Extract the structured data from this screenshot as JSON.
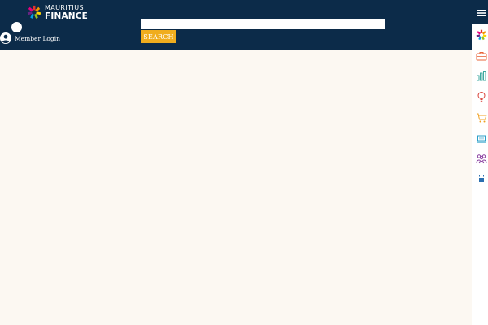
{
  "brand": {
    "logo_line1": "MAURITIUS",
    "logo_line2": "FINANCE",
    "logo_colors": [
      "#e6332a",
      "#f39200",
      "#ffd500",
      "#95c11f",
      "#009fe3",
      "#662483",
      "#e5007e"
    ]
  },
  "header": {
    "background": "#0c2b49",
    "member_login_label": "Member Login",
    "member_icon": "user-circle-icon",
    "menu_icon": "hamburger-icon"
  },
  "search": {
    "value": "",
    "placeholder": "",
    "button_label": "SEARCH",
    "button_color": "#f0ad1e"
  },
  "side_rail": {
    "items": [
      {
        "icon": "logo-mark-icon"
      },
      {
        "icon": "briefcase-icon",
        "color": "#e8643a"
      },
      {
        "icon": "bar-chart-icon",
        "color": "#3fa9a0"
      },
      {
        "icon": "lightbulb-icon",
        "color": "#d9433a"
      },
      {
        "icon": "shopping-cart-icon",
        "color": "#f0a020"
      },
      {
        "icon": "laptop-icon",
        "color": "#2b9fc9"
      },
      {
        "icon": "people-icon",
        "color": "#8a3fa0"
      },
      {
        "icon": "calendar-icon",
        "color": "#2b6fb0"
      }
    ]
  },
  "main": {
    "background": "#fcf8f2"
  }
}
